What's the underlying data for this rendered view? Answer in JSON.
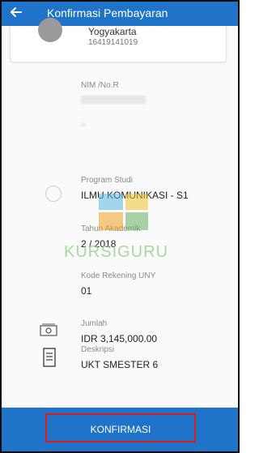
{
  "header": {
    "title": "Konfirmasi Pembayaran"
  },
  "card": {
    "city": "Yogyakarta",
    "code": "16419141019"
  },
  "fields": {
    "nim_label": "NIM /No.R",
    "prodi_label": "Program Studi",
    "prodi_value": "ILMU KOMUNIKASI - S1",
    "tahun_label": "Tahun Akademik",
    "tahun_value": "2 / 2018",
    "kode_label": "Kode Rekening UNY",
    "kode_value": "01",
    "jumlah_label": "Jumlah",
    "jumlah_value": "IDR 3,145,000.00",
    "deskripsi_label": "Deskripsi",
    "deskripsi_value": "UKT SMESTER 6"
  },
  "watermark": {
    "text": "KURSIGURU"
  },
  "footer": {
    "confirm_label": "KONFIRMASI"
  },
  "colors": {
    "primary": "#1f74c9",
    "highlight": "#e11b1b",
    "watermark": "#8fcc86"
  }
}
